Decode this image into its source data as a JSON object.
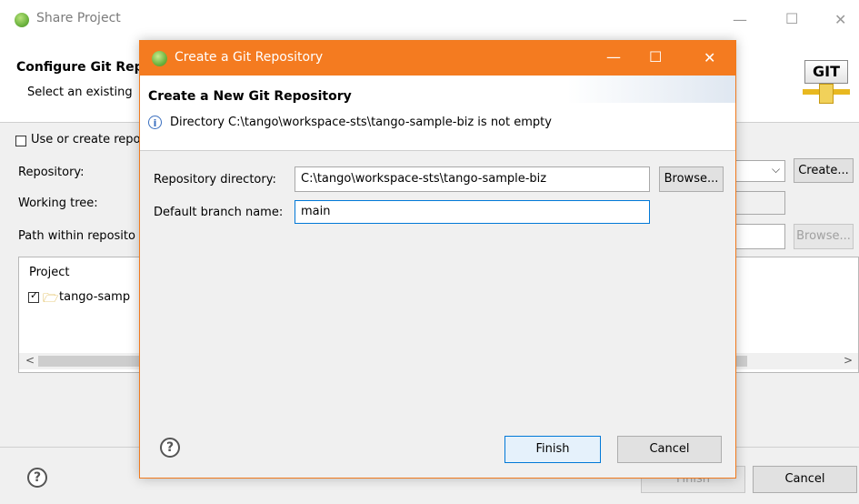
{
  "background_window": {
    "title": "Share Project",
    "header_title": "Configure Git Rep",
    "header_subtitle": "Select an existing",
    "use_repo_label": "Use or create repo",
    "repository_label": "Repository:",
    "working_tree_label": "Working tree:",
    "path_label": "Path within reposito",
    "create_button": "Create...",
    "browse_button": "Browse...",
    "project_column": "Project",
    "project_item": "tango-samp",
    "finish_button": "Finish",
    "cancel_button": "Cancel",
    "git_logo_text": "GIT",
    "scroll_left": "<",
    "scroll_right": ">",
    "help_glyph": "?"
  },
  "dialog": {
    "title": "Create a Git Repository",
    "header_title": "Create a New Git Repository",
    "info_glyph": "i",
    "message": "Directory C:\\tango\\workspace-sts\\tango-sample-biz is not empty",
    "repo_dir_label": "Repository directory:",
    "repo_dir_value": "C:\\tango\\workspace-sts\\tango-sample-biz",
    "browse_button": "Browse...",
    "branch_label": "Default branch name:",
    "branch_value": "main",
    "finish_button": "Finish",
    "cancel_button": "Cancel",
    "help_glyph": "?"
  },
  "window_controls": {
    "minimize": "—",
    "maximize": "☐",
    "close": "✕"
  },
  "colors": {
    "dialog_title_bar": "#f47b20",
    "focus_border": "#0078d7"
  },
  "icons": {
    "app": "spring-leaf-icon",
    "info": "info-icon",
    "help": "help-icon",
    "folder": "folder-icon",
    "dropdown": "chevron-down-icon"
  }
}
